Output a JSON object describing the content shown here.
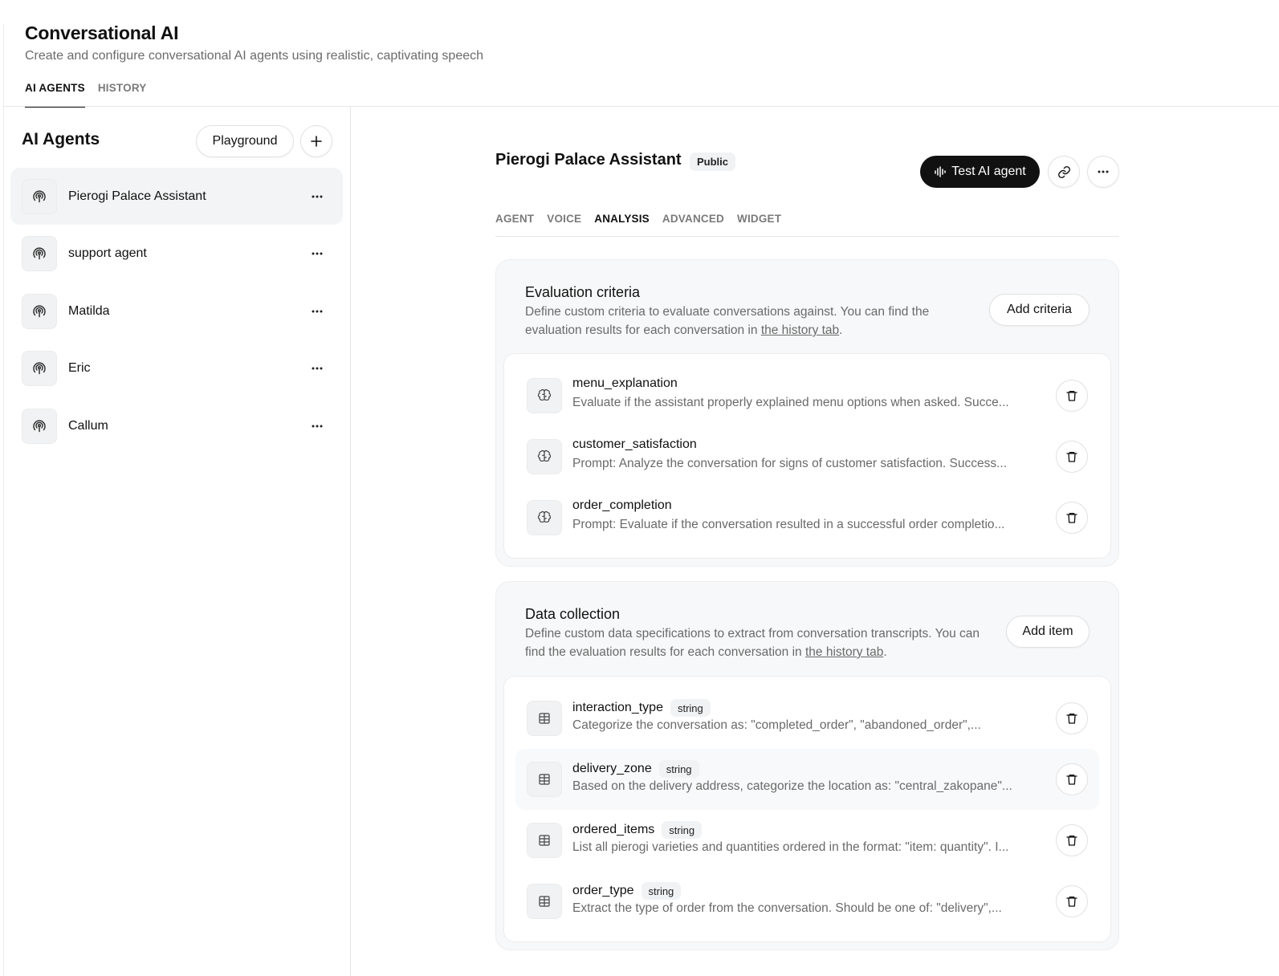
{
  "header": {
    "title": "Conversational AI",
    "subtitle": "Create and configure conversational AI agents using realistic, captivating speech",
    "tabs": [
      {
        "label": "AI AGENTS",
        "active": true
      },
      {
        "label": "HISTORY",
        "active": false
      }
    ]
  },
  "sidebar": {
    "title": "AI Agents",
    "playground_label": "Playground",
    "add_icon": "plus-icon",
    "agents": [
      {
        "name": "Pierogi Palace Assistant",
        "active": true
      },
      {
        "name": "support agent",
        "active": false
      },
      {
        "name": "Matilda",
        "active": false
      },
      {
        "name": "Eric",
        "active": false
      },
      {
        "name": "Callum",
        "active": false
      }
    ]
  },
  "agent": {
    "name": "Pierogi Palace Assistant",
    "visibility": "Public",
    "test_label": "Test AI agent",
    "tabs": [
      {
        "label": "AGENT",
        "active": false
      },
      {
        "label": "VOICE",
        "active": false
      },
      {
        "label": "ANALYSIS",
        "active": true
      },
      {
        "label": "ADVANCED",
        "active": false
      },
      {
        "label": "WIDGET",
        "active": false
      }
    ]
  },
  "evaluation": {
    "title": "Evaluation criteria",
    "description_pre": "Define custom criteria to evaluate conversations against. You can find the evaluation results for each conversation in ",
    "link_text": "the history tab",
    "description_post": ".",
    "add_label": "Add criteria",
    "items": [
      {
        "name": "menu_explanation",
        "description": "Evaluate if the assistant properly explained menu options when asked. Succe..."
      },
      {
        "name": "customer_satisfaction",
        "description": "Prompt: Analyze the conversation for signs of customer satisfaction. Success..."
      },
      {
        "name": "order_completion",
        "description": "Prompt: Evaluate if the conversation resulted in a successful order completio..."
      }
    ]
  },
  "data_collection": {
    "title": "Data collection",
    "description_pre": "Define custom data specifications to extract from conversation transcripts. You can find the evaluation results for each conversation in ",
    "link_text": "the history tab",
    "description_post": ".",
    "add_label": "Add item",
    "items": [
      {
        "name": "interaction_type",
        "type": "string",
        "description": "Categorize the conversation as: \"completed_order\", \"abandoned_order\",..."
      },
      {
        "name": "delivery_zone",
        "type": "string",
        "description": "Based on the delivery address, categorize the location as: \"central_zakopane\"..."
      },
      {
        "name": "ordered_items",
        "type": "string",
        "description": "List all pierogi varieties and quantities ordered in the format: \"item: quantity\". I..."
      },
      {
        "name": "order_type",
        "type": "string",
        "description": "Extract the type of order from the conversation. Should be one of: \"delivery\",..."
      }
    ]
  },
  "colors": {
    "accent": "#111111",
    "muted_text": "#6a6a6a",
    "panel_bg": "#f7f8f9",
    "border": "#e1e1e1"
  }
}
